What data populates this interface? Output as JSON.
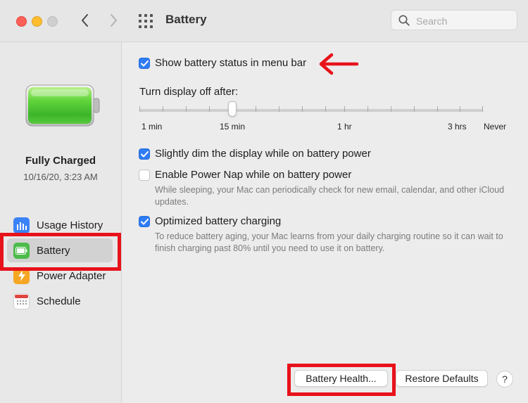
{
  "window": {
    "title": "Battery",
    "search_placeholder": "Search"
  },
  "sidebar": {
    "status_title": "Fully Charged",
    "status_date": "10/16/20, 3:23 AM",
    "items": [
      {
        "label": "Usage History",
        "icon": "bar-chart-icon",
        "color": "#3b82f6"
      },
      {
        "label": "Battery",
        "icon": "battery-icon",
        "color": "#4cbb4a",
        "selected": true
      },
      {
        "label": "Power Adapter",
        "icon": "lightning-icon",
        "color": "#f5a623"
      },
      {
        "label": "Schedule",
        "icon": "calendar-icon",
        "color": "#e0443e"
      }
    ]
  },
  "settings": {
    "show_status": {
      "label": "Show battery status in menu bar",
      "checked": true
    },
    "display_off": {
      "label": "Turn display off after:",
      "ticks": [
        "1 min",
        "15 min",
        "1 hr",
        "3 hrs",
        "Never"
      ],
      "value": "15 min"
    },
    "dim_display": {
      "label": "Slightly dim the display while on battery power",
      "checked": true
    },
    "power_nap": {
      "label": "Enable Power Nap while on battery power",
      "checked": false,
      "description": "While sleeping, your Mac can periodically check for new email, calendar, and other iCloud updates."
    },
    "optimized_charging": {
      "label": "Optimized battery charging",
      "checked": true,
      "description": "To reduce battery aging, your Mac learns from your daily charging routine so it can wait to finish charging past 80% until you need to use it on battery."
    }
  },
  "buttons": {
    "battery_health": "Battery Health...",
    "restore_defaults": "Restore Defaults",
    "help": "?"
  },
  "colors": {
    "accent": "#2e7cf6",
    "highlight": "#e8121b",
    "battery_green": "#5cd63a"
  }
}
